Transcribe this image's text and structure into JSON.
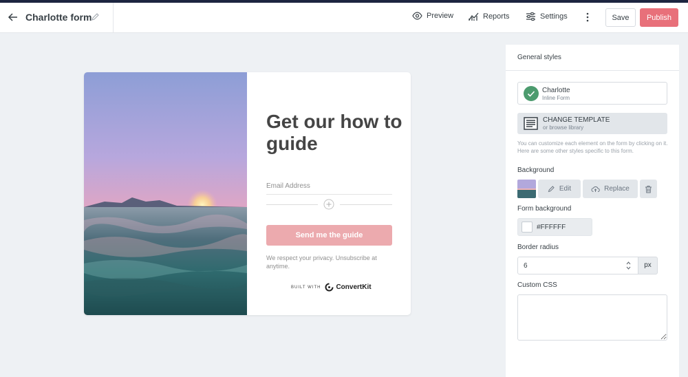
{
  "header": {
    "form_title": "Charlotte form",
    "nav": {
      "preview": "Preview",
      "reports": "Reports",
      "settings": "Settings"
    },
    "save_label": "Save",
    "publish_label": "Publish",
    "icons": [
      "back-arrow-icon",
      "pencil-icon",
      "eye-icon",
      "chart-icon",
      "sliders-icon",
      "kebab-icon"
    ]
  },
  "form_preview": {
    "headline": "Get our how to guide",
    "email_placeholder": "Email Address",
    "button_label": "Send me the guide",
    "privacy_text": "We respect your privacy. Unsubscribe at anytime.",
    "built_with": "BUILT WITH",
    "brand": "ConvertKit",
    "button_color": "#ecaaae"
  },
  "sidebar": {
    "title": "General styles",
    "template": {
      "name": "Charlotte",
      "type": "Inline Form"
    },
    "change_template": {
      "label": "CHANGE TEMPLATE",
      "sublabel": "or browse library"
    },
    "help_text": "You can customize each element on the form by clicking on it. Here are some other styles specific to this form.",
    "background": {
      "label": "Background",
      "edit_label": "Edit",
      "replace_label": "Replace"
    },
    "form_background": {
      "label": "Form background",
      "value": "#FFFFFF"
    },
    "border_radius": {
      "label": "Border radius",
      "value": "6",
      "unit": "px"
    },
    "custom_css": {
      "label": "Custom CSS",
      "value": ""
    }
  },
  "colors": {
    "accent": "#e8707a",
    "success": "#4c9b6e",
    "top_strip": "#1d2540"
  }
}
